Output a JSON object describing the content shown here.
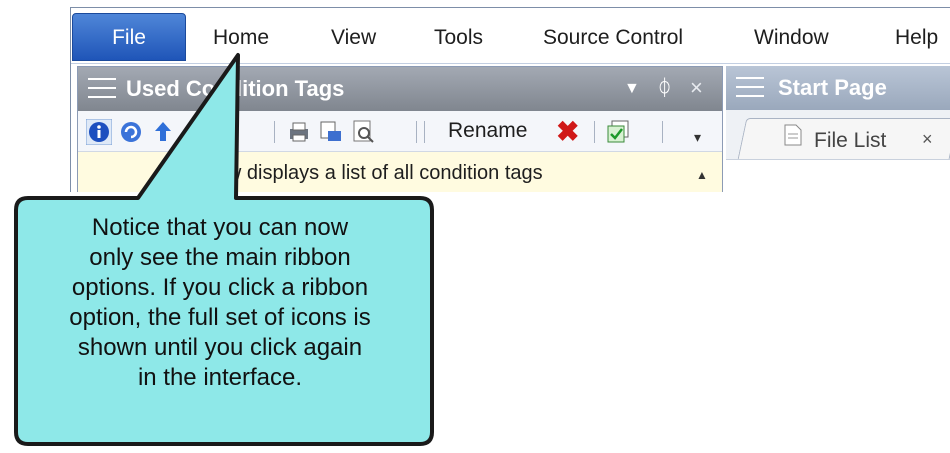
{
  "menubar": {
    "file": "File",
    "items": [
      "Home",
      "View",
      "Tools",
      "Source Control",
      "Window",
      "Help"
    ]
  },
  "left_panel": {
    "title": "Used Condition Tags",
    "pin_icon": "pin-icon",
    "close_icon": "close-icon",
    "toolbar": {
      "rename_label": "Rename"
    },
    "info_text": "This view displays a list of all condition tags"
  },
  "right_panel": {
    "title": "Start Page",
    "tab_label": "File List",
    "tab_close": "×"
  },
  "callout": {
    "lines": [
      "Notice that you can now",
      "only see the main ribbon",
      "options. If you click a ribbon",
      "option, the full set of icons is",
      "shown until you click again",
      "in the interface."
    ]
  },
  "colors": {
    "callout_fill": "#8ee8e8",
    "file_tab": "#2f64c4",
    "panel_title": "#8b919a",
    "info_bg": "#fffbe0"
  }
}
